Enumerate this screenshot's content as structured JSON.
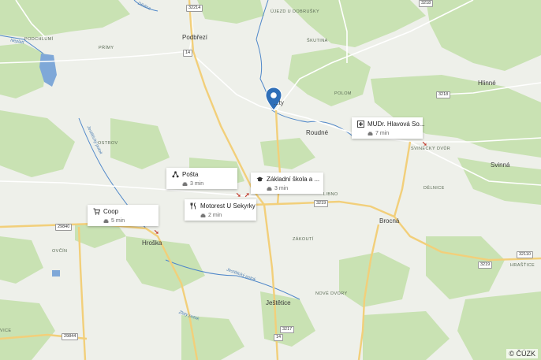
{
  "map": {
    "marker_label": "...ty",
    "attribution": "© ČÚZK",
    "towns": [
      "Podbřezí",
      "Roudné",
      "Hlinné",
      "Svinná",
      "Brocná",
      "Hroška",
      "Ještětice"
    ],
    "localities": [
      "PODCHLUMÍ",
      "PŘÍMY",
      "ŠKUTINA",
      "POLOM",
      "OSTROV",
      "SVINECKÝ DVŮR",
      "DĚLNICE",
      "ZÁKOUTÍ",
      "NOVÉ DVORY",
      "OVČÍN",
      "HRAŠŤICE",
      "VICE",
      "LIBNO"
    ],
    "streams": [
      "Dědina",
      "Neplatt",
      "Jestětický potok",
      "Jestětický potok",
      "Zlatý potok"
    ],
    "top_label": "ÚJEZD U DOBRUŠKY",
    "road_numbers": [
      "32214",
      "3218",
      "14",
      "3218",
      "3219",
      "29840",
      "3219",
      "32110",
      "3217",
      "14",
      "29844"
    ]
  },
  "pois": [
    {
      "title": "Pošta",
      "time": "3 min",
      "icon": "post-office-icon"
    },
    {
      "title": "Základní škola a ...",
      "time": "3 min",
      "icon": "school-icon"
    },
    {
      "title": "Motorest U Sekyrky",
      "time": "2 min",
      "icon": "restaurant-icon"
    },
    {
      "title": "Coop",
      "time": "5 min",
      "icon": "shopping-cart-icon"
    },
    {
      "title": "MUDr. Hlavová So...",
      "time": "7 min",
      "icon": "medical-icon"
    }
  ],
  "colors": {
    "forest": "#c9e2b3",
    "road_major": "#f6d78a",
    "road_minor": "#ffffff",
    "water": "#7fa8d8",
    "stream": "#4f87c9",
    "marker": "#2f6fb8"
  }
}
